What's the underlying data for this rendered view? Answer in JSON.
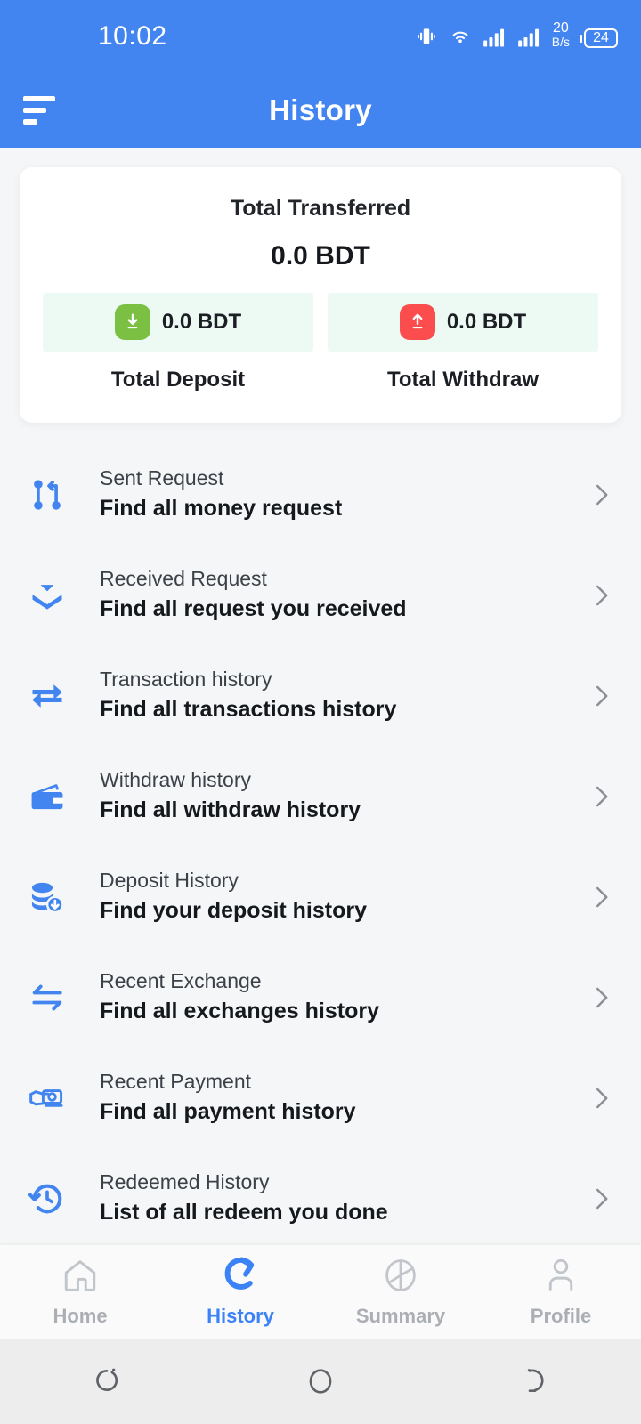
{
  "status_bar": {
    "time": "10:02",
    "network_speed_value": "20",
    "network_speed_unit": "B/s",
    "battery_level": "24",
    "icons": [
      "vibrate-icon",
      "wifi-icon",
      "signal-icon",
      "signal-icon",
      "battery-icon"
    ]
  },
  "app_bar": {
    "title": "History",
    "menu_icon": "hamburger-menu-icon"
  },
  "summary_card": {
    "label": "Total Transferred",
    "amount": "0.0 BDT",
    "deposit": {
      "value": "0.0 BDT",
      "caption": "Total Deposit",
      "icon": "download-arrow-icon",
      "color": "#7BC043"
    },
    "withdraw": {
      "value": "0.0 BDT",
      "caption": "Total Withdraw",
      "icon": "upload-arrow-icon",
      "color": "#FB4D4D"
    },
    "box_background": "#EDF9F3"
  },
  "menu_items": [
    {
      "title": "Sent Request",
      "subtitle": "Find all money request",
      "icon": "pull-request-icon"
    },
    {
      "title": "Received Request",
      "subtitle": "Find all request you received",
      "icon": "double-chevron-down-icon"
    },
    {
      "title": "Transaction history",
      "subtitle": "Find all transactions history",
      "icon": "exchange-arrows-icon"
    },
    {
      "title": "Withdraw history",
      "subtitle": "Find all withdraw history",
      "icon": "wallet-icon"
    },
    {
      "title": "Deposit History",
      "subtitle": "Find your deposit history",
      "icon": "coins-download-icon"
    },
    {
      "title": "Recent Exchange",
      "subtitle": "Find all exchanges history",
      "icon": "swap-arrows-icon"
    },
    {
      "title": "Recent Payment",
      "subtitle": "Find all payment history",
      "icon": "hand-money-icon"
    },
    {
      "title": "Redeemed History",
      "subtitle": "List of all redeem you done",
      "icon": "clock-rotate-left-icon"
    }
  ],
  "bottom_nav": {
    "items": [
      {
        "label": "Home",
        "icon": "home-icon",
        "active": false
      },
      {
        "label": "History",
        "icon": "history-icon",
        "active": true
      },
      {
        "label": "Summary",
        "icon": "pie-chart-icon",
        "active": false
      },
      {
        "label": "Profile",
        "icon": "person-icon",
        "active": false
      }
    ],
    "active_color": "#3B82F6",
    "inactive_color": "#ABAFB4"
  },
  "system_bar": {
    "buttons": [
      "recents-button",
      "home-button",
      "back-button"
    ]
  },
  "theme": {
    "primary": "#4285F0",
    "background": "#F5F6F7",
    "icon_blue": "#4285F0"
  }
}
